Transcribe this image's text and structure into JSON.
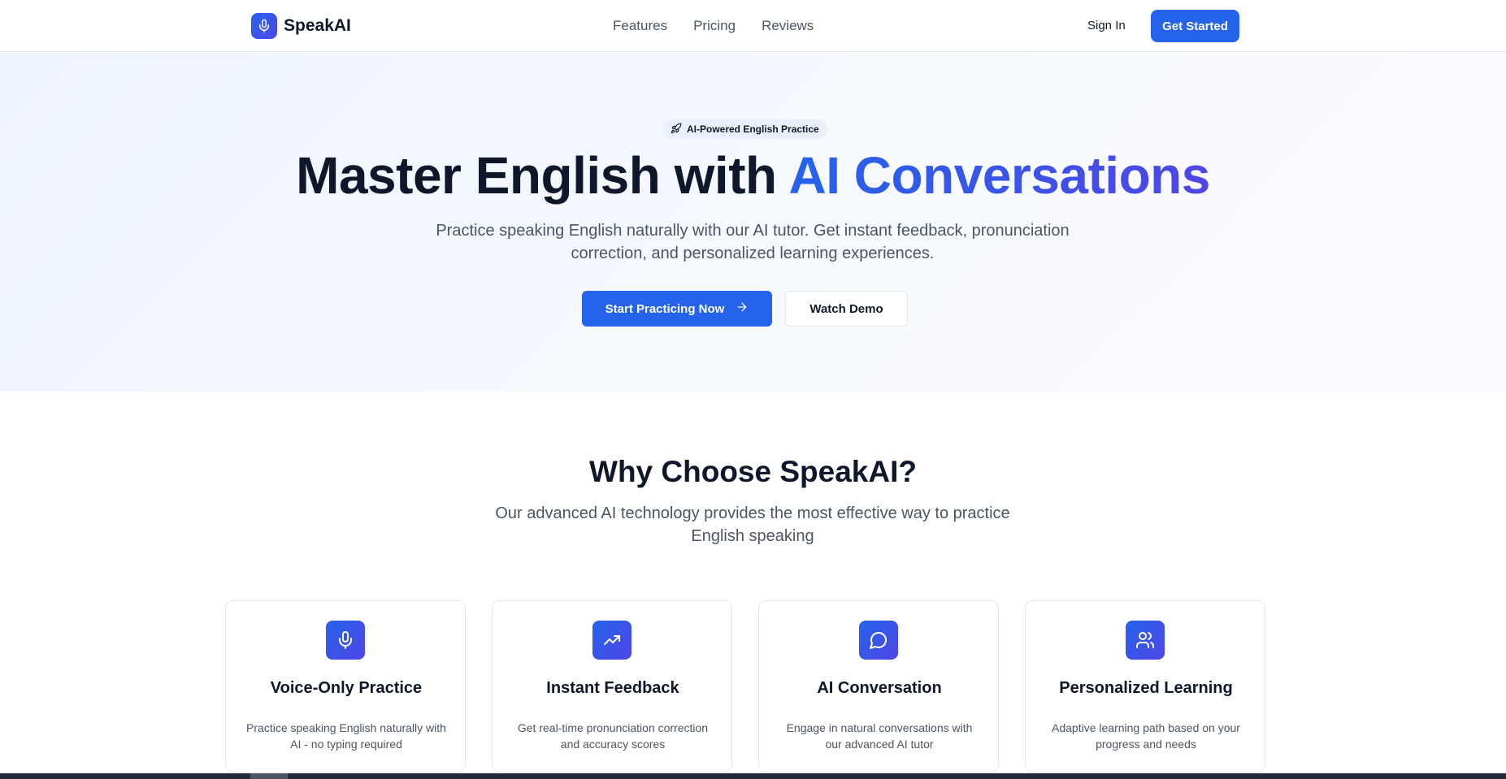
{
  "nav": {
    "logo_text": "SpeakAI",
    "links": [
      "Features",
      "Pricing",
      "Reviews"
    ],
    "sign_in": "Sign In",
    "get_started": "Get Started"
  },
  "hero": {
    "badge": "AI-Powered English Practice",
    "headline_plain": "Master English with ",
    "headline_accent": "AI Conversations",
    "subtext": "Practice speaking English naturally with our AI tutor. Get instant feedback, pronunciation correction, and personalized learning experiences.",
    "primary_button": "Start Practicing Now",
    "secondary_button": "Watch Demo"
  },
  "why": {
    "title": "Why Choose SpeakAI?",
    "subtitle": "Our advanced AI technology provides the most effective way to practice English speaking",
    "cards": [
      {
        "icon": "microphone-icon",
        "title": "Voice-Only Practice",
        "desc": "Practice speaking English naturally with AI - no typing required"
      },
      {
        "icon": "trending-up-icon",
        "title": "Instant Feedback",
        "desc": "Get real-time pronunciation correction and accuracy scores"
      },
      {
        "icon": "chat-bubble-icon",
        "title": "AI Conversation",
        "desc": "Engage in natural conversations with our advanced AI tutor"
      },
      {
        "icon": "users-icon",
        "title": "Personalized Learning",
        "desc": "Adaptive learning path based on your progress and needs"
      }
    ]
  },
  "colors": {
    "primary": "#2563eb",
    "accent_gradient_end": "#4f46e5",
    "heading": "#0f172a",
    "body_text": "#4b5563"
  }
}
